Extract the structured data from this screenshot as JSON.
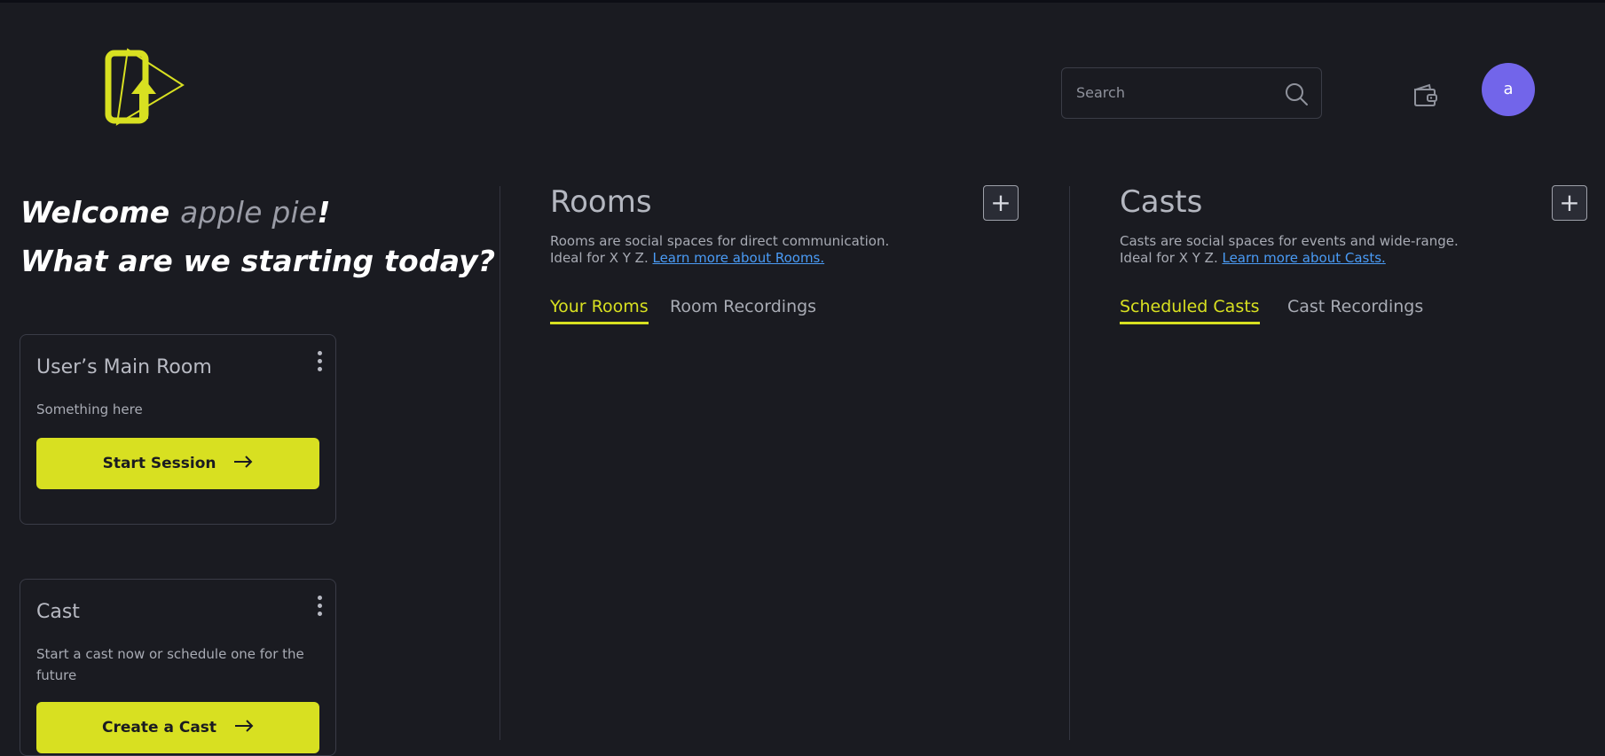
{
  "header": {
    "logo_name": "app-logo",
    "search_placeholder": "Search",
    "avatar_initial": "a"
  },
  "welcome": {
    "greeting": "Welcome ",
    "user_name": "apple pie",
    "exclaim": "!",
    "subtitle": "What are we starting today?"
  },
  "cards": [
    {
      "title": "User’s Main Room",
      "description": "Something here",
      "button_label": "Start Session"
    },
    {
      "title": "Cast",
      "description": "Start a cast now or schedule one for the future",
      "button_label": "Create a Cast"
    }
  ],
  "rooms": {
    "title": "Rooms",
    "desc_line1": "Rooms are social spaces for direct communication.",
    "desc_line2_prefix": "Ideal for X Y Z. ",
    "link": "Learn more about Rooms.",
    "add_label": "+",
    "tabs": [
      "Your Rooms",
      "Room Recordings"
    ]
  },
  "casts": {
    "title": "Casts",
    "desc_line1": "Casts are social spaces for events and wide-range.",
    "desc_line2_prefix": "Ideal for X Y Z. ",
    "link": "Learn more about Casts.",
    "add_label": "+",
    "tabs": [
      "Scheduled Casts",
      "Cast Recordings"
    ]
  },
  "colors": {
    "background": "#1a1b21",
    "accent": "#d8e021",
    "avatar": "#7265ea",
    "link": "#4a9bf5"
  },
  "icons": [
    "app-logo",
    "search-icon",
    "wallet-icon",
    "kebab-menu-icon",
    "arrow-right-icon",
    "plus-icon"
  ]
}
